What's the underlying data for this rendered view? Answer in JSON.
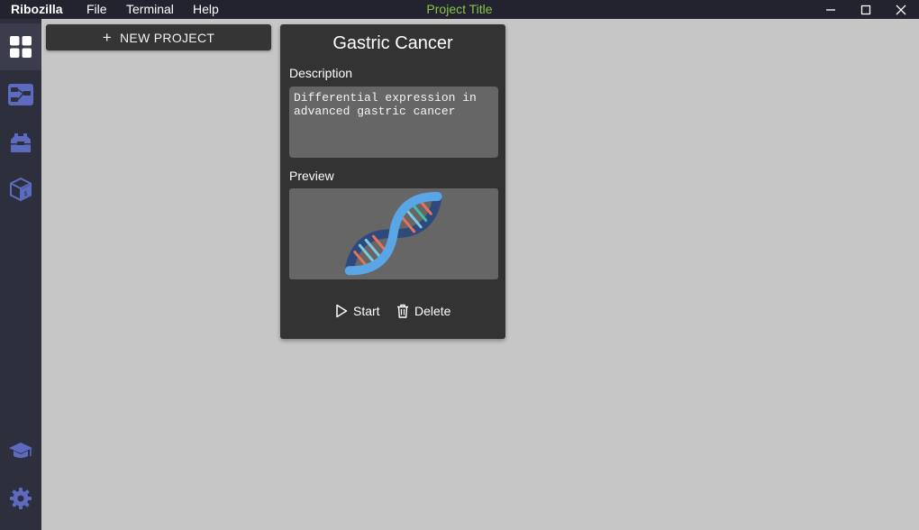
{
  "titlebar": {
    "app_name": "Ribozilla",
    "menu": [
      "File",
      "Terminal",
      "Help"
    ],
    "project_title": "Project Title",
    "project_title_color": "#8bc34a",
    "window_controls": [
      "minimize-icon",
      "maximize-icon",
      "close-icon"
    ]
  },
  "sidebar": {
    "items": [
      {
        "icon": "dashboard-grid-icon",
        "active": true
      },
      {
        "icon": "workflow-icon",
        "active": false
      },
      {
        "icon": "toolbox-icon",
        "active": false
      },
      {
        "icon": "package-box-icon",
        "active": false
      }
    ],
    "bottom_items": [
      {
        "icon": "graduation-cap-icon"
      },
      {
        "icon": "gear-icon"
      }
    ],
    "icon_color": "#5c6bc0"
  },
  "toolbar": {
    "new_project_label": "NEW PROJECT"
  },
  "project_card": {
    "title": "Gastric Cancer",
    "description_label": "Description",
    "description_text": "Differential expression in advanced gastric cancer",
    "preview_label": "Preview",
    "preview_image": "dna-helix-icon",
    "start_label": "Start",
    "delete_label": "Delete"
  }
}
